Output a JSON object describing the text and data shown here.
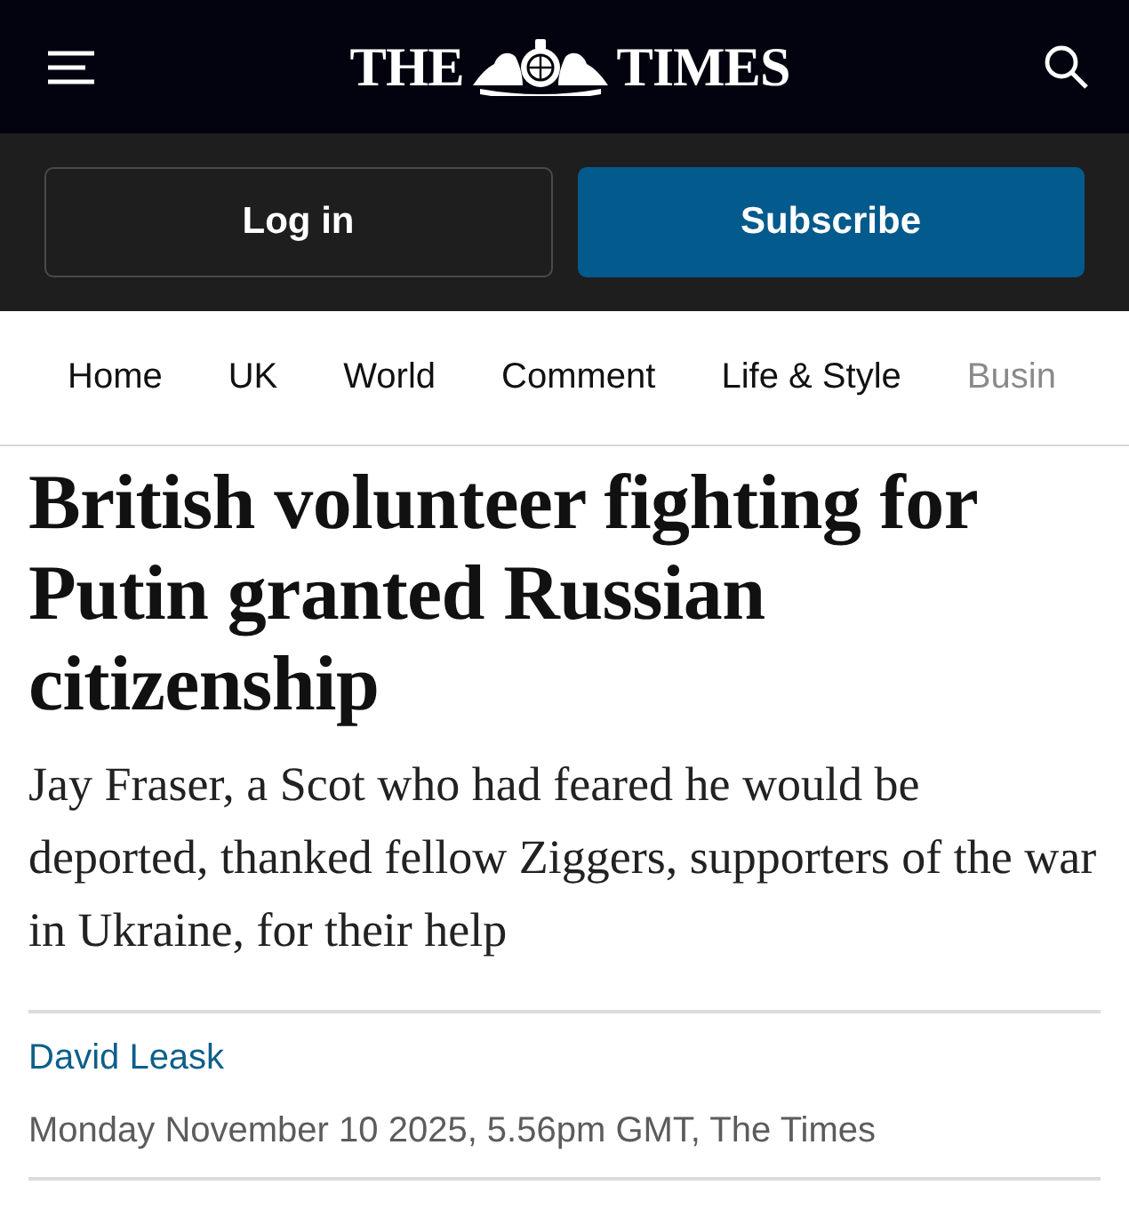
{
  "header": {
    "logo_left": "THE",
    "logo_right": "TIMES"
  },
  "account": {
    "login": "Log in",
    "subscribe": "Subscribe"
  },
  "nav": [
    {
      "label": "Home",
      "faded": false
    },
    {
      "label": "UK",
      "faded": false
    },
    {
      "label": "World",
      "faded": false
    },
    {
      "label": "Comment",
      "faded": false
    },
    {
      "label": "Life & Style",
      "faded": false
    },
    {
      "label": "Busin",
      "faded": true
    }
  ],
  "article": {
    "headline": "British volunteer fighting for Putin granted Russian citizenship",
    "standfirst": "Jay Fraser, a Scot who had feared he would be deported, thanked fellow Ziggers, supporters of the war in Ukraine, for their help",
    "author": "David Leask",
    "dateline": "Monday November 10 2025, 5.56pm GMT, The Times"
  }
}
